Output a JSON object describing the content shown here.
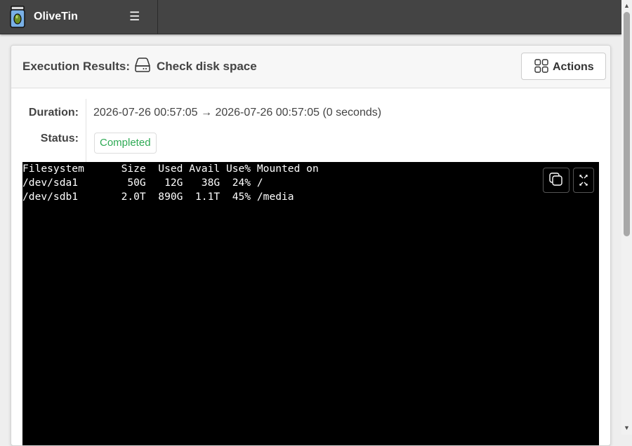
{
  "app": {
    "title": "OliveTin",
    "menu_icon": "hamburger-menu-icon",
    "logo": "olive-jar-logo"
  },
  "execution": {
    "heading": "Execution Results:",
    "action_icon": "hard-drive-icon",
    "action_name": "Check disk space",
    "actions_button": {
      "label": "Actions",
      "icon": "grid-icon"
    },
    "duration_label": "Duration:",
    "duration_value": "2026-07-26 00:57:05 → 2026-07-26 00:57:05 (0 seconds)",
    "status_label": "Status:",
    "status_value": "Completed"
  },
  "terminal": {
    "lines": [
      "Filesystem      Size  Used Avail Use% Mounted on",
      "/dev/sda1        50G   12G   38G  24% /",
      "/dev/sdb1       2.0T  890G  1.1T  45% /media"
    ],
    "copy_icon": "copy-icon",
    "fullscreen_icon": "fullscreen-icon"
  },
  "colors": {
    "topbar": "#444444",
    "status_green": "#2eaa54",
    "terminal_bg": "#000000"
  }
}
